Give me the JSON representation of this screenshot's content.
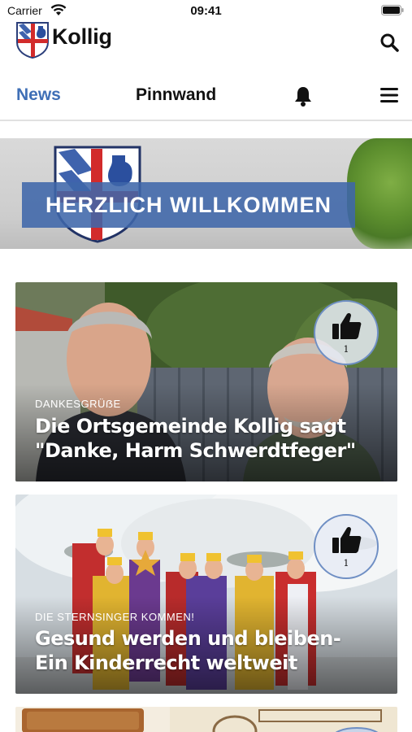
{
  "status_bar": {
    "carrier": "Carrier",
    "time": "09:41"
  },
  "app": {
    "title": "Kollig",
    "accent_color": "#3f6fb6",
    "logo": "kollig-coat-of-arms"
  },
  "header": {
    "search_icon": "search-icon"
  },
  "tabs": [
    {
      "label": "News",
      "active": true
    },
    {
      "label": "Pinnwand",
      "active": false
    }
  ],
  "toolbar": {
    "notifications_icon": "bell-icon",
    "menu_icon": "hamburger-menu-icon"
  },
  "banner": {
    "text": "HERZLICH WILLKOMMEN"
  },
  "news": [
    {
      "category": "DANKESGRÜẞE",
      "title": "Die Ortsgemeinde Kollig sagt \"Danke, Harm Schwerdtfeger\"",
      "likes": "1",
      "like_icon": "thumbs-up-icon"
    },
    {
      "category": "DIE STERNSINGER KOMMEN!",
      "title": "Gesund werden und bleiben- Ein Kinderrecht weltweit",
      "likes": "1",
      "like_icon": "thumbs-up-icon"
    },
    {
      "category": "",
      "title": ""
    }
  ]
}
